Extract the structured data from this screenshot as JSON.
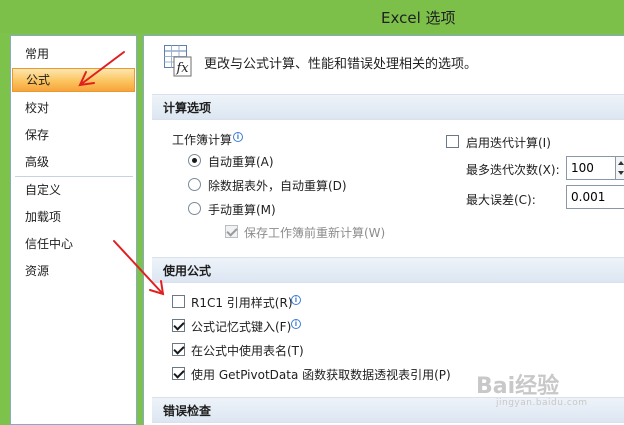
{
  "window": {
    "title": "Excel 选项"
  },
  "sidebar": {
    "items": [
      {
        "label": "常用"
      },
      {
        "label": "公式",
        "active": true
      },
      {
        "label": "校对"
      },
      {
        "label": "保存"
      },
      {
        "label": "高级"
      },
      {
        "label": "自定义"
      },
      {
        "label": "加载项"
      },
      {
        "label": "信任中心"
      },
      {
        "label": "资源"
      }
    ]
  },
  "banner": {
    "text": "更改与公式计算、性能和错误处理相关的选项。",
    "icon": "fx-function-icon"
  },
  "calc": {
    "heading": "计算选项",
    "workbook_label": "工作簿计算",
    "auto": "自动重算(A)",
    "auto_except": "除数据表外，自动重算(D)",
    "manual": "手动重算(M)",
    "recalc_before_save": "保存工作簿前重新计算(W)",
    "iterative": "启用迭代计算(I)",
    "max_iter_label": "最多迭代次数(X):",
    "max_iter_value": "100",
    "max_change_label": "最大误差(C):",
    "max_change_value": "0.001"
  },
  "formulas": {
    "heading": "使用公式",
    "r1c1": "R1C1 引用样式(R)",
    "autocomplete": "公式记忆式键入(F)",
    "table_names": "在公式中使用表名(T)",
    "getpivotdata": "使用 GetPivotData 函数获取数据透视表引用(P)"
  },
  "errors": {
    "heading": "错误检查"
  },
  "annotation_color": "#e02020",
  "watermark": {
    "logo": "Bai经验",
    "url": "jingyan.baidu.com"
  }
}
